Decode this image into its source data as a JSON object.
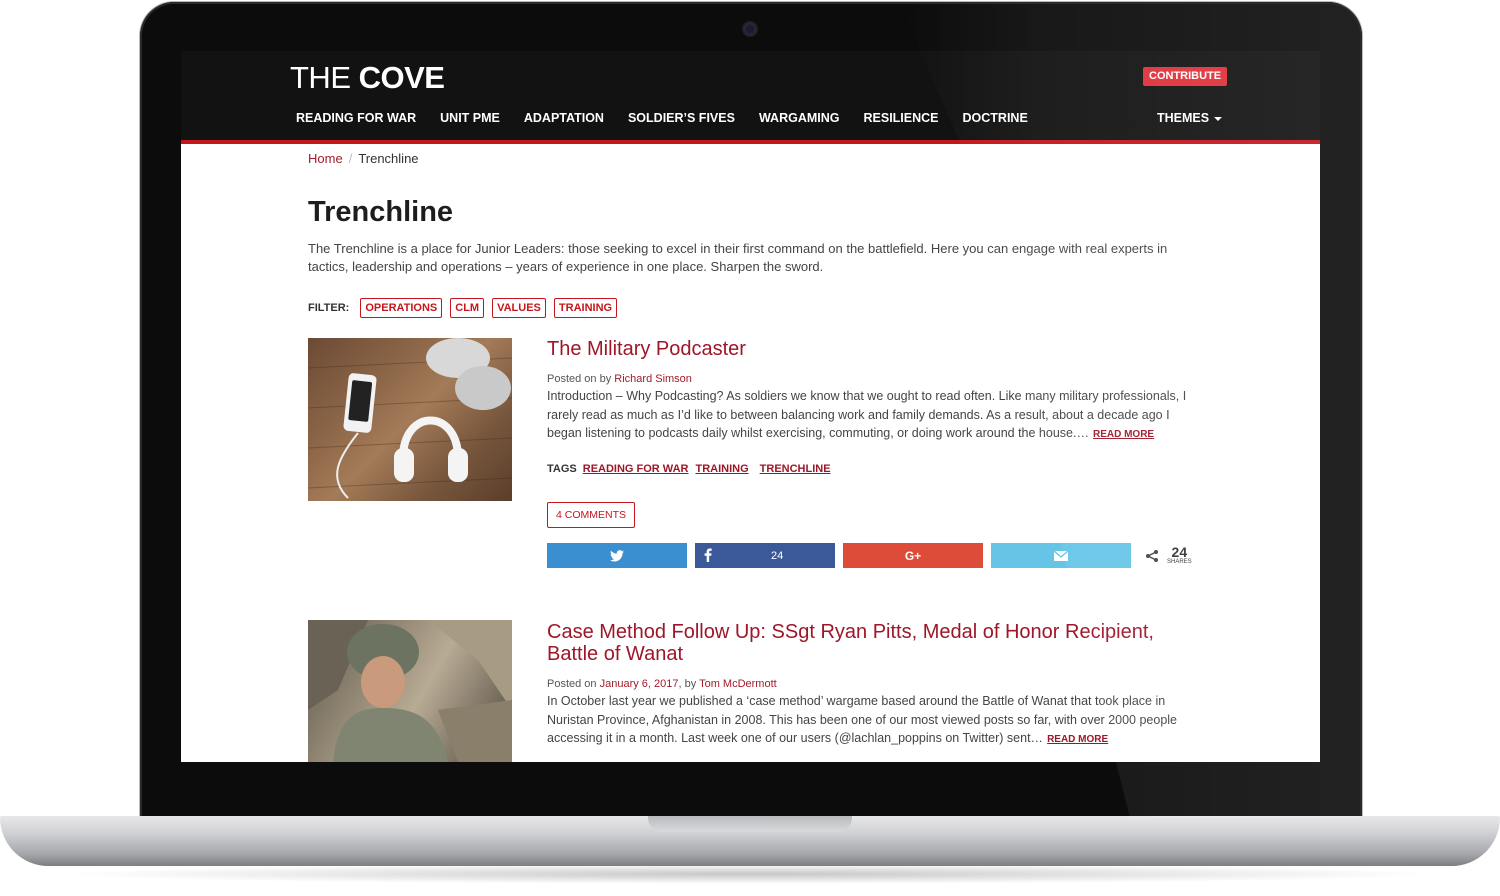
{
  "site": {
    "logo_light": "THE ",
    "logo_bold": "COVE",
    "contribute": "CONTRIBUTE",
    "nav": [
      "READING FOR WAR",
      "UNIT PME",
      "ADAPTATION",
      "SOLDIER’S FIVES",
      "WARGAMING",
      "RESILIENCE",
      "DOCTRINE"
    ],
    "themes": "THEMES"
  },
  "breadcrumb": {
    "home": "Home",
    "separator": "/",
    "current": "Trenchline"
  },
  "page": {
    "title": "Trenchline",
    "intro": "The Trenchline is a place for Junior Leaders: those seeking to excel in their first command on the battlefield. Here you can engage with real experts in tactics, leadership and operations – years of experience in one place. Sharpen the sword."
  },
  "filter": {
    "label": "FILTER:",
    "options": [
      "OPERATIONS",
      "CLM",
      "VALUES",
      "TRAINING"
    ]
  },
  "posts": [
    {
      "title": "The Military Podcaster",
      "meta_prefix": "Posted on by ",
      "author": "Richard Simson",
      "excerpt": "Introduction – Why Podcasting? As soldiers we know that we ought to read often. Like many military professionals, I rarely read as much as I’d like to between balancing work and family demands. As a result, about a decade ago I began listening to podcasts daily whilst exercising, commuting, or doing work around the house.…",
      "read_more": "READ MORE",
      "tags_label": "TAGS",
      "tags": [
        "READING FOR WAR",
        "TRAINING",
        "TRENCHLINE"
      ],
      "comments": "4 COMMENTS",
      "share": {
        "facebook_count": "24",
        "total": "24",
        "total_label": "SHARES"
      }
    },
    {
      "title": "Case Method Follow Up: SSgt Ryan Pitts, Medal of Honor Recipient, Battle of Wanat",
      "meta_prefix": "Posted on ",
      "date": "January 6, 2017",
      "meta_by": ", by ",
      "author": "Tom McDermott",
      "excerpt": "In October last year we published a ‘case method’ wargame based around the Battle of Wanat that took place in Nuristan Province, Afghanistan in 2008.  This has been one of our most viewed posts so far, with over 2000 people accessing it in a month. Last week one of our users (@lachlan_poppins on Twitter) sent…",
      "read_more": "READ MORE"
    }
  ],
  "colors": {
    "accent": "#c4161c",
    "link": "#9e1628",
    "header_bg": "#121212"
  },
  "icons": [
    "twitter-icon",
    "facebook-icon",
    "google-plus-icon",
    "email-icon",
    "share-icon",
    "caret-down-icon",
    "webcam-icon"
  ]
}
